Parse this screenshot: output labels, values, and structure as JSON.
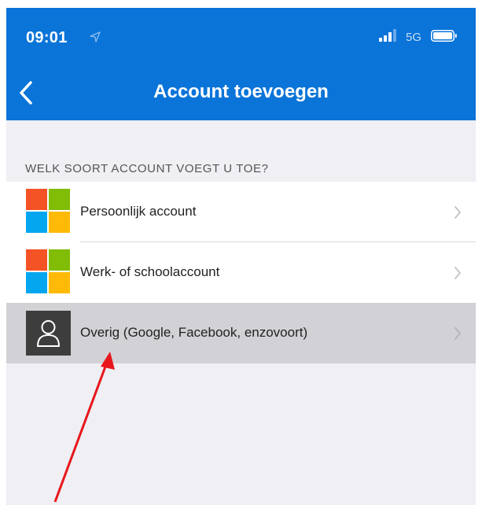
{
  "status_bar": {
    "time": "09:01",
    "network": "5G",
    "icons": [
      "location-arrow-icon",
      "signal-bars-icon",
      "battery-icon"
    ]
  },
  "nav": {
    "title": "Account toevoegen",
    "back_icon": "chevron-left-icon"
  },
  "section": {
    "header": "WELK SOORT ACCOUNT VOEGT U TOE?"
  },
  "accounts": [
    {
      "label": "Persoonlijk account",
      "icon": "microsoft-logo-icon",
      "selected": false
    },
    {
      "label": "Werk- of schoolaccount",
      "icon": "microsoft-logo-icon",
      "selected": false
    },
    {
      "label": "Overig (Google, Facebook, enzovoort)",
      "icon": "user-icon",
      "selected": true
    }
  ],
  "colors": {
    "header_bg": "#0a74d8",
    "page_bg": "#efeff4",
    "selected_row_bg": "#d1d1d6",
    "annotation_arrow": "#e8161b",
    "ms_red": "#f35325",
    "ms_green": "#81bc06",
    "ms_blue": "#05a6f0",
    "ms_yellow": "#ffba08"
  }
}
